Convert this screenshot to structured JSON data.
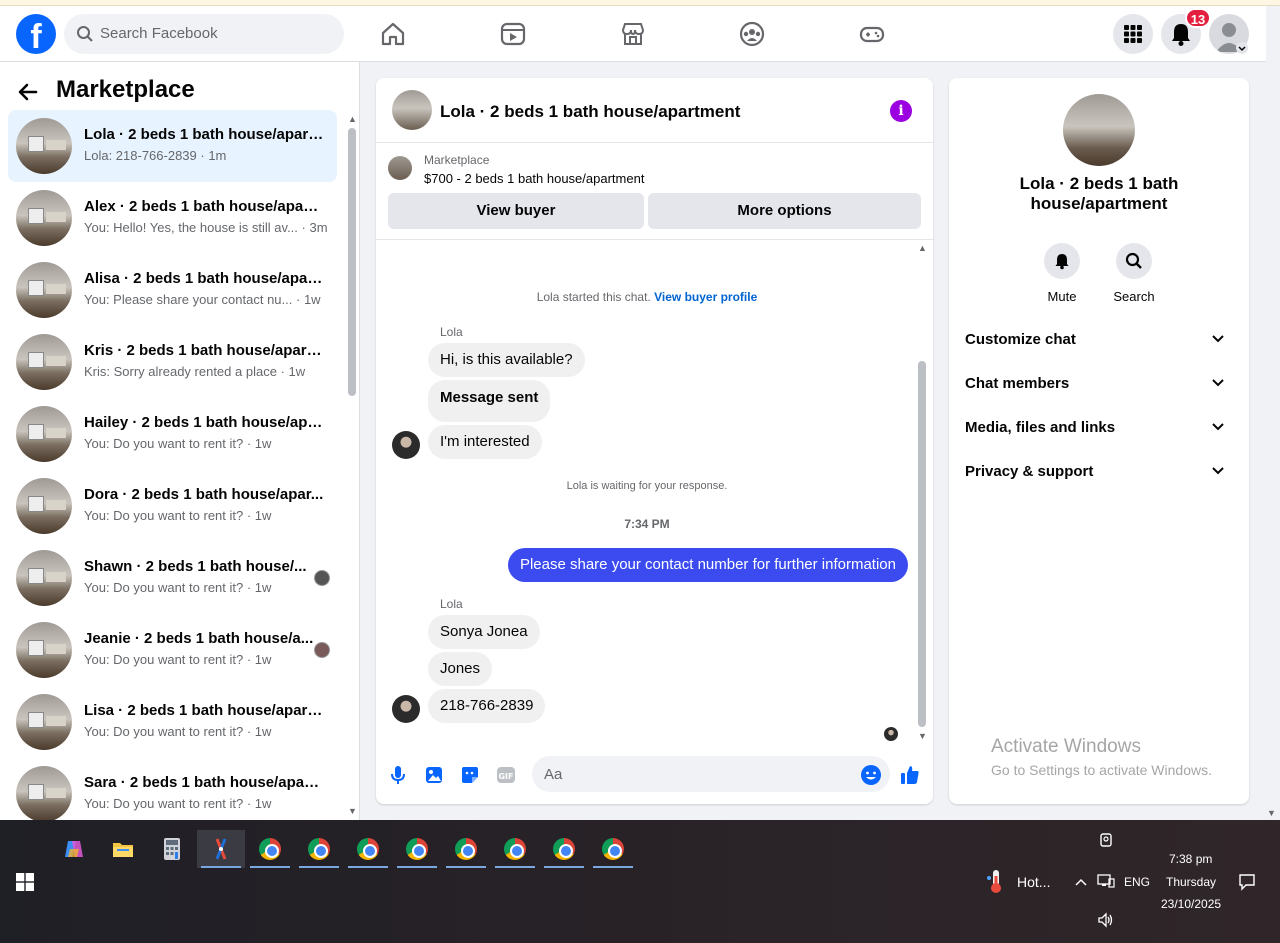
{
  "topbar": {
    "logo": "f",
    "search_placeholder": "Search Facebook",
    "notification_count": "13"
  },
  "left": {
    "title": "Marketplace",
    "conversations": [
      {
        "name": "Lola · 2 beds 1 bath house/apart...",
        "snippet": "Lola: 218-766-2839",
        "time": "· 1m"
      },
      {
        "name": "Alex · 2 beds 1 bath house/apart...",
        "snippet": "You: Hello! Yes, the house is still av...",
        "time": "· 3m"
      },
      {
        "name": "Alisa · 2 beds 1 bath house/apar...",
        "snippet": "You: Please share your contact nu...",
        "time": "· 1w"
      },
      {
        "name": "Kris · 2 beds 1 bath house/apart...",
        "snippet": "Kris: Sorry already rented a place",
        "time": "· 1w"
      },
      {
        "name": "Hailey · 2 beds 1 bath house/apa...",
        "snippet": "You: Do you want to rent it?",
        "time": "· 1w"
      },
      {
        "name": "Dora · 2 beds 1 bath house/apar...",
        "snippet": "You: Do you want to rent it?",
        "time": "· 1w"
      },
      {
        "name": "Shawn · 2 beds 1 bath house/...",
        "snippet": "You: Do you want to rent it?",
        "time": "· 1w"
      },
      {
        "name": "Jeanie · 2 beds 1 bath house/a...",
        "snippet": "You: Do you want to rent it?",
        "time": "· 1w"
      },
      {
        "name": "Lisa · 2 beds 1 bath house/apart...",
        "snippet": "You: Do you want to rent it?",
        "time": "· 1w"
      },
      {
        "name": "Sara · 2 beds 1 bath house/apart...",
        "snippet": "You: Do you want to rent it?",
        "time": "· 1w"
      }
    ]
  },
  "chat": {
    "title": "Lola · 2 beds 1 bath house/apartment",
    "marketplace_label": "Marketplace",
    "listing": "$700 - 2 beds 1 bath house/apartment",
    "view_buyer": "View buyer",
    "more_options": "More options",
    "started_note": "Lola started this chat.",
    "view_profile": "View buyer profile",
    "sender1": "Lola",
    "msg1": "Hi, is this available?",
    "msg2": "Message sent",
    "msg3": "I'm interested",
    "waiting": "Lola is waiting for your response.",
    "timestamp": "7:34 PM",
    "msg_out": "Please share your contact number for further information",
    "sender2": "Lola",
    "msg4": "Sonya Jonea",
    "msg5": "Jones",
    "msg6": "218-766-2839",
    "input_placeholder": "Aa"
  },
  "right": {
    "title": "Lola · 2 beds 1 bath house/apartment",
    "mute": "Mute",
    "search": "Search",
    "sections": [
      "Customize chat",
      "Chat members",
      "Media, files and links",
      "Privacy & support"
    ]
  },
  "watermark": {
    "line1": "Activate Windows",
    "line2": "Go to Settings to activate Windows."
  },
  "taskbar": {
    "weather": "Hot...",
    "lang": "ENG",
    "time": "7:38 pm",
    "day": "Thursday",
    "date": "23/10/2025"
  },
  "colors": {
    "brand": "#0866ff",
    "outgoing_bubble": "#3b4bf0",
    "info_icon": "#9b00e0",
    "badge": "#e41e3f"
  }
}
